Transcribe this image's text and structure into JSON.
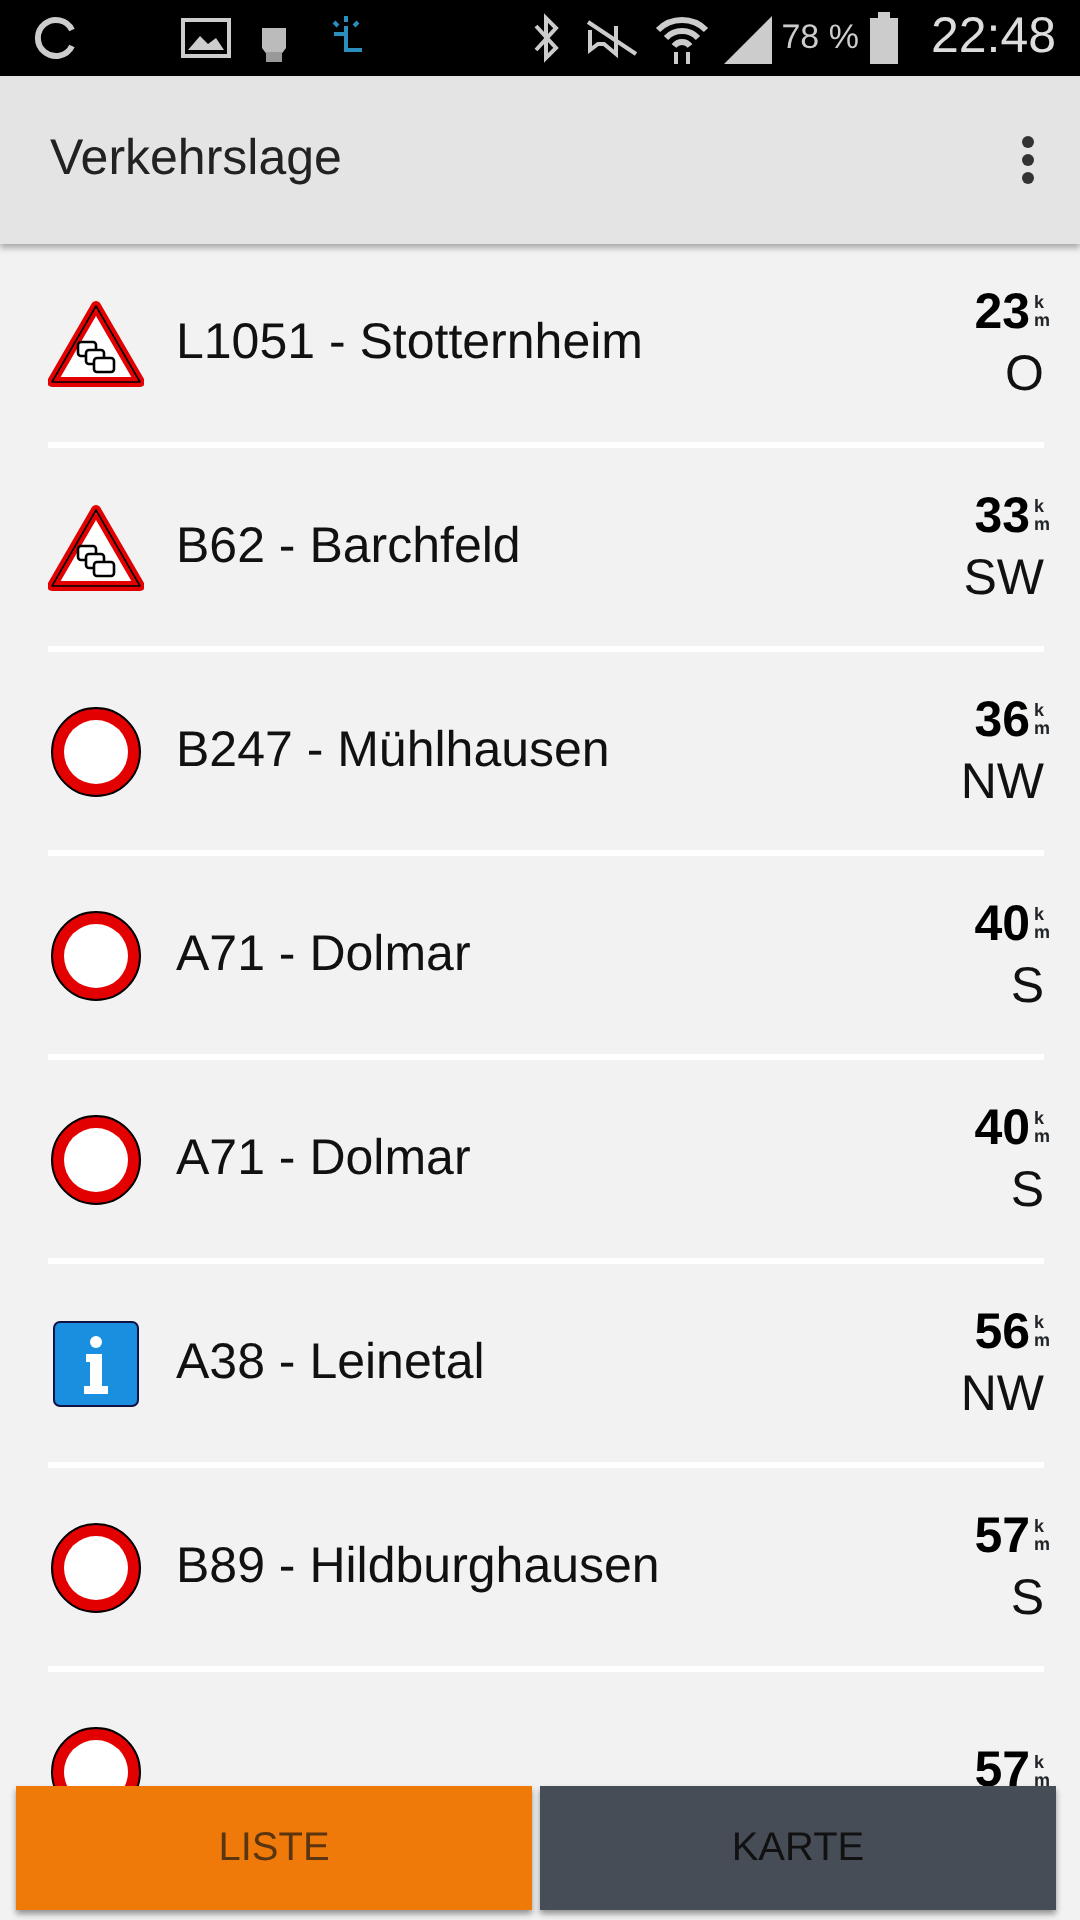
{
  "status_bar": {
    "battery": "78 %",
    "time": "22:48"
  },
  "app_bar": {
    "title": "Verkehrslage"
  },
  "items": [
    {
      "kind": "traffic-jam",
      "name": "L1051 - Stotternheim",
      "distance": "23",
      "unit": "km",
      "direction": "O"
    },
    {
      "kind": "traffic-jam",
      "name": "B62 - Barchfeld",
      "distance": "33",
      "unit": "km",
      "direction": "SW"
    },
    {
      "kind": "closure",
      "name": "B247 - Mühlhausen",
      "distance": "36",
      "unit": "km",
      "direction": "NW"
    },
    {
      "kind": "closure",
      "name": "A71 - Dolmar",
      "distance": "40",
      "unit": "km",
      "direction": "S"
    },
    {
      "kind": "closure",
      "name": "A71 - Dolmar",
      "distance": "40",
      "unit": "km",
      "direction": "S"
    },
    {
      "kind": "info",
      "name": "A38 - Leinetal",
      "distance": "56",
      "unit": "km",
      "direction": "NW"
    },
    {
      "kind": "closure",
      "name": "B89 - Hildburghausen",
      "distance": "57",
      "unit": "km",
      "direction": "S"
    },
    {
      "kind": "closure",
      "distance": "57",
      "unit": "km"
    }
  ],
  "tabs": [
    {
      "label": "LISTE",
      "selected": true
    },
    {
      "label": "KARTE",
      "selected": false
    }
  ]
}
